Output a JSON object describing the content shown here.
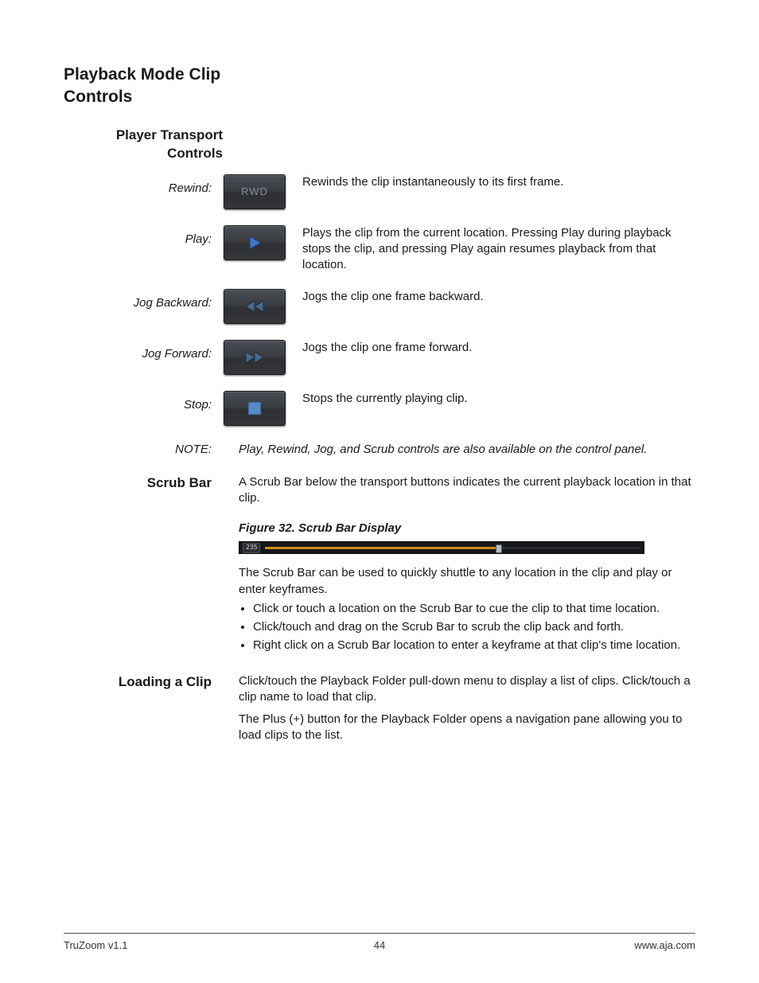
{
  "heading": "Playback Mode Clip Controls",
  "subheading": "Player Transport Controls",
  "controls": {
    "rewind": {
      "label": "Rewind:",
      "btn_text": "RWD",
      "desc": "Rewinds the clip instantaneously to its first frame."
    },
    "play": {
      "label": "Play:",
      "desc": "Plays the clip from the current location. Pressing Play during playback stops the clip, and pressing Play again resumes playback from that location."
    },
    "jog_backward": {
      "label": "Jog Backward:",
      "desc": "Jogs the clip one frame backward."
    },
    "jog_forward": {
      "label": "Jog Forward:",
      "desc": "Jogs the clip one frame forward."
    },
    "stop": {
      "label": "Stop:",
      "desc": "Stops the currently playing clip."
    }
  },
  "note": {
    "label": "NOTE:",
    "text": "Play, Rewind, Jog, and Scrub controls are also available on the control panel."
  },
  "scrub": {
    "label": "Scrub Bar",
    "intro": "A Scrub Bar below the transport buttons indicates the current playback location in that clip.",
    "figure_caption": "Figure 32. Scrub Bar Display",
    "frame_counter": "235",
    "after_figure": "The Scrub Bar can be used to quickly shuttle to any location in the clip and play or enter keyframes.",
    "bullets": [
      "Click or touch a location on the Scrub Bar to cue the clip to that time location.",
      "Click/touch and drag on the Scrub Bar to scrub the clip back and forth.",
      "Right click on a Scrub Bar location to enter a keyframe at that clip's time location."
    ]
  },
  "loading": {
    "label": "Loading a Clip",
    "p1": "Click/touch the Playback Folder pull-down menu to display a list of clips. Click/touch a clip name to load that clip.",
    "p2": "The Plus (+) button for the Playback Folder opens a navigation pane allowing you to load clips to the list."
  },
  "footer": {
    "left": "TruZoom v1.1",
    "center": "44",
    "right": "www.aja.com"
  }
}
